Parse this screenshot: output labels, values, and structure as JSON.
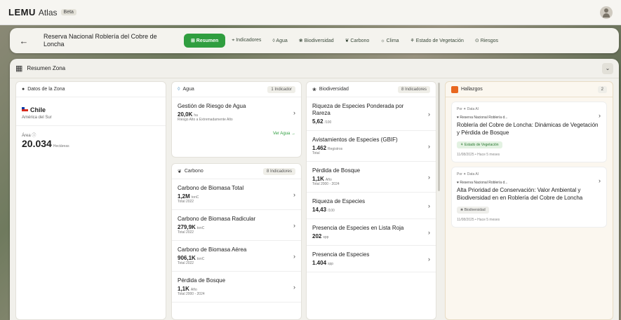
{
  "app": {
    "logo": "LEMU",
    "name": "Atlas",
    "beta": "Beta"
  },
  "nav": {
    "back": "←",
    "title": "Reserva Nacional Roblería del Cobre de Loncha",
    "tabs": [
      {
        "label": "⊞ Resumen",
        "active": true
      },
      {
        "label": "⌖ Indicadores"
      },
      {
        "label": "◊ Agua"
      },
      {
        "label": "❀ Biodiversidad"
      },
      {
        "label": "❦ Carbono"
      },
      {
        "label": "☼ Clima"
      },
      {
        "label": "⚘ Estado de Vegetación"
      },
      {
        "label": "⊙ Riesgos"
      }
    ]
  },
  "panel": {
    "title": "Resumen Zona",
    "collapse": "⌄"
  },
  "zona": {
    "header": "Datos de la Zona",
    "country": "Chile",
    "region": "América del Sur",
    "area_label": "Área ⓘ",
    "area_value": "20.034",
    "area_unit": "Hectáreas"
  },
  "agua": {
    "header": "Agua",
    "badge": "1 Indicador",
    "item": {
      "title": "Gestión de Riesgo de Agua",
      "value": "20,0K",
      "unit": "ha",
      "sub": "Riesgo Alto a Extremadamente Alto"
    },
    "link": "Ver Agua →"
  },
  "carbono": {
    "header": "Carbono",
    "badge": "8 Indicadores",
    "items": [
      {
        "title": "Carbono de Biomasa Total",
        "value": "1,2M",
        "unit": "tonC",
        "sub": "Total 2022"
      },
      {
        "title": "Carbono de Biomasa Radicular",
        "value": "279,9K",
        "unit": "tonC",
        "sub": "Total 2022"
      },
      {
        "title": "Carbono de Biomasa Aérea",
        "value": "906,1K",
        "unit": "tonC",
        "sub": "Total 2022"
      },
      {
        "title": "Pérdida de Bosque",
        "value": "1,1K",
        "unit": "Año",
        "sub": "Total 2000 - 2024"
      }
    ]
  },
  "bio": {
    "header": "Biodiversidad",
    "badge": "8 Indicadores",
    "items": [
      {
        "title": "Riqueza de Especies Ponderada por Rareza",
        "value": "5,62",
        "unit": "/100",
        "sub": ""
      },
      {
        "title": "Avistamientos de Especies (GBIF)",
        "value": "1.462",
        "unit": "Registros",
        "sub": "Total"
      },
      {
        "title": "Pérdida de Bosque",
        "value": "1,1K",
        "unit": "Año",
        "sub": "Total 2000 - 2024"
      },
      {
        "title": "Riqueza de Especies",
        "value": "14,43",
        "unit": "/100",
        "sub": ""
      },
      {
        "title": "Presencia de Especies en Lista Roja",
        "value": "202",
        "unit": "spp",
        "sub": ""
      },
      {
        "title": "Presencia de Especies",
        "value": "1.404",
        "unit": "spp",
        "sub": ""
      }
    ]
  },
  "hallazgos": {
    "header": "Hallazgos",
    "count": "2",
    "cards": [
      {
        "by": "Por ✦ Data AI",
        "loc": "♥ Reserva Nacional Roblería d...",
        "title": "Roblería del Cobre de Loncha: Dinámicas de Vegetación y Pérdida de Bosque",
        "tag": "⚘ Estado de Vegetación",
        "date": "11/08/2025 • Hace 5 meses"
      },
      {
        "by": "Por ✦ Data AI",
        "loc": "♥ Reserva Nacional Roblería d...",
        "title": "Alta Prioridad de Conservación: Valor Ambiental y Biodiversidad en en Roblería del Cobre de Loncha",
        "tag": "❀ Biodiversidad",
        "date": "11/08/2025 • Hace 5 meses"
      }
    ]
  }
}
